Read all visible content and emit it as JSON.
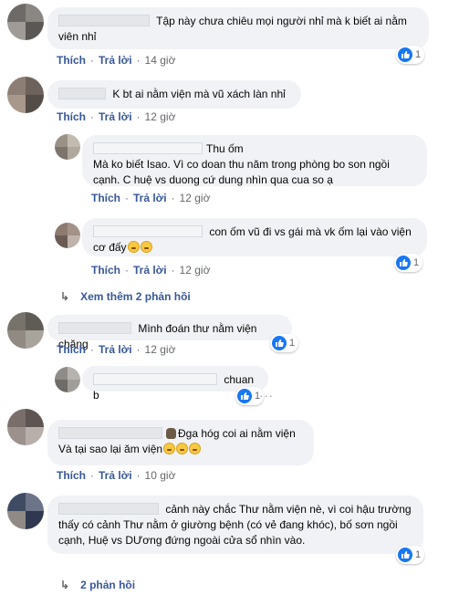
{
  "actions": {
    "like": "Thích",
    "reply": "Trả lời"
  },
  "comments": [
    {
      "text": "Tập này chưa chiêu mọi người nhỉ mà k biết ai nằm viên nhỉ",
      "time": "14 giờ",
      "likes": "1",
      "avatar_colors": [
        "#6d6a67",
        "#8a8682",
        "#a09b96",
        "#5b5754"
      ]
    },
    {
      "text": "K bt ai nằm viện mà vũ xách làn nhỉ",
      "time": "12 giờ",
      "avatar_colors": [
        "#8c7e75",
        "#6e635c",
        "#a8978b",
        "#544c46"
      ]
    },
    {
      "name": "Thu ốm",
      "text": "Mà ko biết Isao. Vì co doan thu năm trong phòng bo son ngồi cạnh. C huệ vs duong cứ dung nhìn qua cua so ạ",
      "time": "12 giờ",
      "avatar_colors": [
        "#9a9287",
        "#c3bbb0",
        "#7d756c",
        "#b0a89d"
      ]
    },
    {
      "text": "con ốm vũ đi vs gái mà vk ốm lại vào viện cơ đấy",
      "time": "12 giờ",
      "likes": "1",
      "avatar_colors": [
        "#8d7b70",
        "#a39288",
        "#6a5c54",
        "#c0b3aa"
      ]
    },
    {
      "text": "Mình đoán thư nằm viện chăng",
      "time": "12 giờ",
      "likes": "1",
      "avatar_colors": [
        "#77726a",
        "#5f5b55",
        "#908a82",
        "#a8a39b"
      ]
    },
    {
      "text": "chuan b",
      "likes": "1",
      "avatar_colors": [
        "#8f8c88",
        "#b7b3ae",
        "#6f6c68",
        "#a19e9a"
      ]
    },
    {
      "line1": "Đga hóg coi ai nằm viện",
      "line2": "Và tại sao lại ăm viện",
      "time": "10 giờ",
      "avatar_colors": [
        "#7a6e6b",
        "#5e5452",
        "#9d918d",
        "#b8aeaa"
      ]
    },
    {
      "text": "cảnh này chắc Thư nằm viện nè, vì coi hậu trường thấy có cảnh Thư nằm ở giường bệnh (có vẻ đang khóc), bố sơn ngồi cạnh, Huệ vs DƯơng đứng ngoài cửa sổ nhìn vào.",
      "likes": "1",
      "avatar_colors": [
        "#3f4a63",
        "#6b7488",
        "#8f8a86",
        "#2f3850"
      ]
    }
  ],
  "see_more_replies": "Xem thêm 2 phản hồi",
  "more_replies": "2 phản hồi",
  "colors": {
    "bubble": "#f0f2f5",
    "link": "#385898",
    "meta": "#65676b",
    "like_blue": "#1877f2"
  }
}
